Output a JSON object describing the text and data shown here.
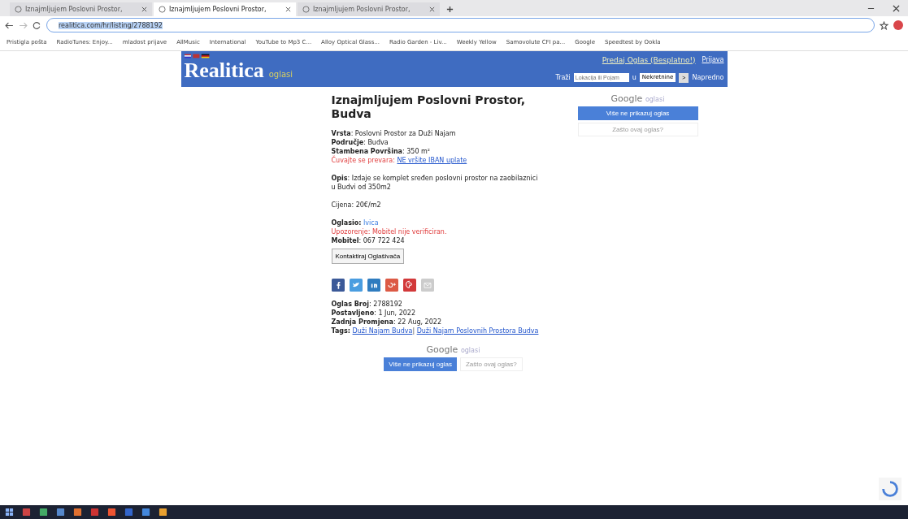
{
  "browser": {
    "tabs": [
      {
        "title": "Iznajmljujem Poslovni Prostor,",
        "selected": false
      },
      {
        "title": "Iznajmljujem Poslovni Prostor,",
        "selected": true
      },
      {
        "title": "Iznajmljujem Poslovni Prostor,",
        "selected": false
      }
    ],
    "url": "realitica.com/hr/listing/2788192",
    "bookmarks": [
      "Pristigla pošta",
      "RadioTunes: Enjoy...",
      "mladost prijave",
      "AllMusic",
      "International",
      "YouTube to Mp3 C...",
      "Alloy Optical Glass...",
      "Radio Garden - Liv...",
      "Weekly Yellow",
      "Samovolute CFI pa...",
      "Google",
      "Speedtest by Ookla"
    ]
  },
  "header": {
    "logo": "Realitica",
    "logo_sub": "oglasi",
    "links": [
      "Predaj Oglas (Besplatno!)",
      "Prijava"
    ],
    "search_label": "Traži",
    "search_placeholder": "Lokacija ili Pojam",
    "in_label": "u",
    "category": "Nekretnine",
    "go": ">",
    "advanced": "Napredno"
  },
  "listing": {
    "title": "Iznajmljujem Poslovni Prostor, Budva",
    "facts": [
      "**Vrsta**: Poslovni Prostor za Duži Najam",
      "**Područje**: Budva",
      "**Stambena Površina**: 350 m²"
    ],
    "warning_label": "Čuvajte se prevara:",
    "warning_link": "NE vršite IBAN uplate",
    "description": "**Opis**: Izdaje se komplet sređen poslovni prostor na zaobilaznici u Budvi od 350m2",
    "price": "Cijena: 20€/m2",
    "advertiser_label": "Oglasio:",
    "advertiser": "Ivica",
    "phone_warning": "Upozorenje: Mobitel nije verificiran.",
    "phone": "**Mobitel**: 067 722 424",
    "contact_button": "Kontaktiraj Oglašivača",
    "share": [
      {
        "kind": "facebook",
        "color": "#3b5998"
      },
      {
        "kind": "twitter",
        "color": "#4a9de0"
      },
      {
        "kind": "linkedin",
        "color": "#2f7cbf"
      },
      {
        "kind": "googleplus",
        "color": "#dc5a45"
      },
      {
        "kind": "pinterest",
        "color": "#d2393a"
      },
      {
        "kind": "email",
        "color": "#cccccc"
      }
    ],
    "meta": [
      "**Oglas Broj**: 2788192",
      "**Postavljeno**: 1 Jun, 2022",
      "**Zadnja Promjena**: 22 Aug, 2022"
    ],
    "tags_label": "Tags:",
    "tag_separator": "|",
    "tags": [
      "Duži Najam Budva",
      "Duži Najam Poslovnih Prostora Budva"
    ]
  },
  "ads": [
    {
      "label": "Google",
      "sub": "oglasi",
      "hide": "Više ne prikazuj oglas",
      "why": "Zašto ovaj oglas?"
    },
    {
      "label": "Google",
      "sub": "oglasi",
      "hide": "Više ne prikazuj oglas",
      "why": "Zašto ovaj oglas?"
    }
  ]
}
